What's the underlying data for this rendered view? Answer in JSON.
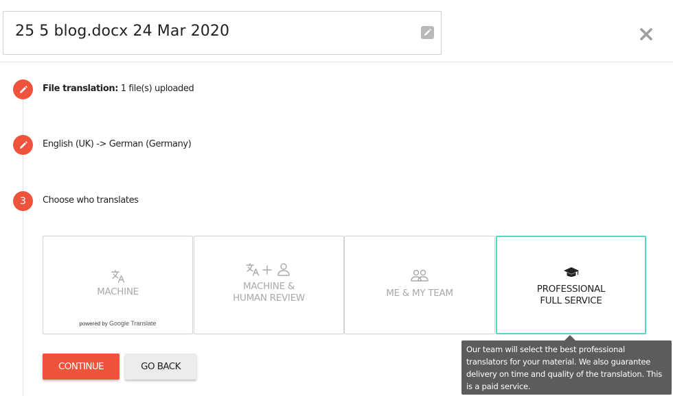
{
  "header": {
    "title": "25 5 blog.docx 24 Mar 2020",
    "edit_icon": "pencil-icon",
    "close_icon": "close-x-icon"
  },
  "steps": [
    {
      "marker": "pencil-icon",
      "label_bold": "File translation:",
      "label_rest": " 1 file(s) uploaded"
    },
    {
      "marker": "pencil-icon",
      "label": "English (UK) -> German (Germany)"
    },
    {
      "marker": "3",
      "label": "Choose who translates"
    }
  ],
  "options": [
    {
      "icon": "translate-icon",
      "line1": "MACHINE",
      "line2": "",
      "powered_prefix": "powered by",
      "powered_brand": "Google Translate",
      "selected": false
    },
    {
      "icon": "translate-plus-person-icon",
      "line1": "MACHINE &",
      "line2": "HUMAN REVIEW",
      "selected": false
    },
    {
      "icon": "team-icon",
      "line1": "ME & MY TEAM",
      "line2": "",
      "selected": false
    },
    {
      "icon": "graduation-cap-icon",
      "line1": "PROFESSIONAL",
      "line2": "FULL SERVICE",
      "selected": true
    }
  ],
  "buttons": {
    "continue": "CONTINUE",
    "back": "GO BACK"
  },
  "tooltip": {
    "lines": [
      "Our team will select the best professional",
      "translators for your material. We also guarantee",
      "delivery on time and quality of the translation. This",
      "is a paid service."
    ]
  },
  "colors": {
    "accent": "#f0533c",
    "selected_border": "#4fd8c4",
    "tooltip_bg": "#5c5c5c",
    "muted_text": "#a9a9a9"
  }
}
